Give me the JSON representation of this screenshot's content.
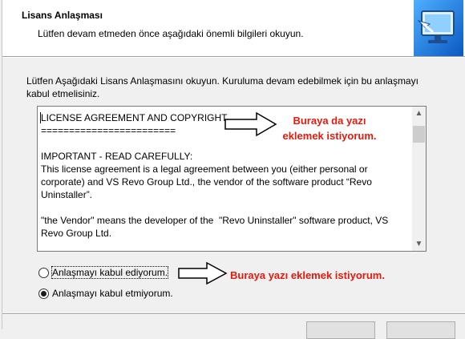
{
  "header": {
    "title": "Lisans Anlaşması",
    "subtitle": "Lütfen devam etmeden önce aşağıdaki önemli bilgileri okuyun.",
    "logo_icon": "setup-monitor-icon"
  },
  "instruction": "Lütfen Aşağıdaki Lisans Anlaşmasını okuyun. Kuruluma devam edebilmek için bu anlaşmayı kabul etmelisiniz.",
  "license": {
    "line1": "LICENSE AGREEMENT AND COPYRIGHT",
    "line2": "========================",
    "line3": "IMPORTANT - READ CAREFULLY:",
    "paragraph1": "This license agreement is a legal agreement between you (either personal or corporate) and VS Revo Group Ltd., the vendor of the software product “Revo Uninstaller”.",
    "paragraph2": "\"the Vendor\" means the developer of the  \"Revo Uninstaller\" software product, VS Revo Group Ltd."
  },
  "options": {
    "accept_label": "Anlaşmayı kabul ediyorum.",
    "decline_label": "Anlaşmayı kabul etmiyorum.",
    "selected": "decline"
  },
  "annotations": {
    "top_line1": "Buraya da yazı",
    "top_line2": "eklemek istiyorum.",
    "bottom": "Buraya yazı eklemek istiyorum."
  },
  "colors": {
    "annotation": "#e8180c",
    "logo_blue": "#1a74d6"
  }
}
